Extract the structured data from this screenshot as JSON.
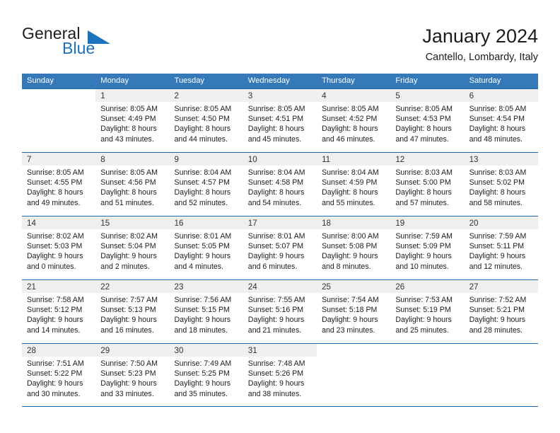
{
  "brand": {
    "name_part1": "General",
    "name_part2": "Blue",
    "flag_icon": "blue-triangle-flag-icon",
    "accent_color": "#1b72bd"
  },
  "header": {
    "title": "January 2024",
    "subtitle": "Cantello, Lombardy, Italy"
  },
  "colors": {
    "header_row_bg": "#3579b8",
    "row_divider": "#1b6bb0",
    "daynum_band_bg": "#efefef",
    "text": "#1c1c1c"
  },
  "calendar": {
    "weekday_headers": [
      "Sunday",
      "Monday",
      "Tuesday",
      "Wednesday",
      "Thursday",
      "Friday",
      "Saturday"
    ],
    "weeks": [
      [
        {
          "day": "",
          "lines": []
        },
        {
          "day": "1",
          "lines": [
            "Sunrise: 8:05 AM",
            "Sunset: 4:49 PM",
            "Daylight: 8 hours",
            "and 43 minutes."
          ]
        },
        {
          "day": "2",
          "lines": [
            "Sunrise: 8:05 AM",
            "Sunset: 4:50 PM",
            "Daylight: 8 hours",
            "and 44 minutes."
          ]
        },
        {
          "day": "3",
          "lines": [
            "Sunrise: 8:05 AM",
            "Sunset: 4:51 PM",
            "Daylight: 8 hours",
            "and 45 minutes."
          ]
        },
        {
          "day": "4",
          "lines": [
            "Sunrise: 8:05 AM",
            "Sunset: 4:52 PM",
            "Daylight: 8 hours",
            "and 46 minutes."
          ]
        },
        {
          "day": "5",
          "lines": [
            "Sunrise: 8:05 AM",
            "Sunset: 4:53 PM",
            "Daylight: 8 hours",
            "and 47 minutes."
          ]
        },
        {
          "day": "6",
          "lines": [
            "Sunrise: 8:05 AM",
            "Sunset: 4:54 PM",
            "Daylight: 8 hours",
            "and 48 minutes."
          ]
        }
      ],
      [
        {
          "day": "7",
          "lines": [
            "Sunrise: 8:05 AM",
            "Sunset: 4:55 PM",
            "Daylight: 8 hours",
            "and 49 minutes."
          ]
        },
        {
          "day": "8",
          "lines": [
            "Sunrise: 8:05 AM",
            "Sunset: 4:56 PM",
            "Daylight: 8 hours",
            "and 51 minutes."
          ]
        },
        {
          "day": "9",
          "lines": [
            "Sunrise: 8:04 AM",
            "Sunset: 4:57 PM",
            "Daylight: 8 hours",
            "and 52 minutes."
          ]
        },
        {
          "day": "10",
          "lines": [
            "Sunrise: 8:04 AM",
            "Sunset: 4:58 PM",
            "Daylight: 8 hours",
            "and 54 minutes."
          ]
        },
        {
          "day": "11",
          "lines": [
            "Sunrise: 8:04 AM",
            "Sunset: 4:59 PM",
            "Daylight: 8 hours",
            "and 55 minutes."
          ]
        },
        {
          "day": "12",
          "lines": [
            "Sunrise: 8:03 AM",
            "Sunset: 5:00 PM",
            "Daylight: 8 hours",
            "and 57 minutes."
          ]
        },
        {
          "day": "13",
          "lines": [
            "Sunrise: 8:03 AM",
            "Sunset: 5:02 PM",
            "Daylight: 8 hours",
            "and 58 minutes."
          ]
        }
      ],
      [
        {
          "day": "14",
          "lines": [
            "Sunrise: 8:02 AM",
            "Sunset: 5:03 PM",
            "Daylight: 9 hours",
            "and 0 minutes."
          ]
        },
        {
          "day": "15",
          "lines": [
            "Sunrise: 8:02 AM",
            "Sunset: 5:04 PM",
            "Daylight: 9 hours",
            "and 2 minutes."
          ]
        },
        {
          "day": "16",
          "lines": [
            "Sunrise: 8:01 AM",
            "Sunset: 5:05 PM",
            "Daylight: 9 hours",
            "and 4 minutes."
          ]
        },
        {
          "day": "17",
          "lines": [
            "Sunrise: 8:01 AM",
            "Sunset: 5:07 PM",
            "Daylight: 9 hours",
            "and 6 minutes."
          ]
        },
        {
          "day": "18",
          "lines": [
            "Sunrise: 8:00 AM",
            "Sunset: 5:08 PM",
            "Daylight: 9 hours",
            "and 8 minutes."
          ]
        },
        {
          "day": "19",
          "lines": [
            "Sunrise: 7:59 AM",
            "Sunset: 5:09 PM",
            "Daylight: 9 hours",
            "and 10 minutes."
          ]
        },
        {
          "day": "20",
          "lines": [
            "Sunrise: 7:59 AM",
            "Sunset: 5:11 PM",
            "Daylight: 9 hours",
            "and 12 minutes."
          ]
        }
      ],
      [
        {
          "day": "21",
          "lines": [
            "Sunrise: 7:58 AM",
            "Sunset: 5:12 PM",
            "Daylight: 9 hours",
            "and 14 minutes."
          ]
        },
        {
          "day": "22",
          "lines": [
            "Sunrise: 7:57 AM",
            "Sunset: 5:13 PM",
            "Daylight: 9 hours",
            "and 16 minutes."
          ]
        },
        {
          "day": "23",
          "lines": [
            "Sunrise: 7:56 AM",
            "Sunset: 5:15 PM",
            "Daylight: 9 hours",
            "and 18 minutes."
          ]
        },
        {
          "day": "24",
          "lines": [
            "Sunrise: 7:55 AM",
            "Sunset: 5:16 PM",
            "Daylight: 9 hours",
            "and 21 minutes."
          ]
        },
        {
          "day": "25",
          "lines": [
            "Sunrise: 7:54 AM",
            "Sunset: 5:18 PM",
            "Daylight: 9 hours",
            "and 23 minutes."
          ]
        },
        {
          "day": "26",
          "lines": [
            "Sunrise: 7:53 AM",
            "Sunset: 5:19 PM",
            "Daylight: 9 hours",
            "and 25 minutes."
          ]
        },
        {
          "day": "27",
          "lines": [
            "Sunrise: 7:52 AM",
            "Sunset: 5:21 PM",
            "Daylight: 9 hours",
            "and 28 minutes."
          ]
        }
      ],
      [
        {
          "day": "28",
          "lines": [
            "Sunrise: 7:51 AM",
            "Sunset: 5:22 PM",
            "Daylight: 9 hours",
            "and 30 minutes."
          ]
        },
        {
          "day": "29",
          "lines": [
            "Sunrise: 7:50 AM",
            "Sunset: 5:23 PM",
            "Daylight: 9 hours",
            "and 33 minutes."
          ]
        },
        {
          "day": "30",
          "lines": [
            "Sunrise: 7:49 AM",
            "Sunset: 5:25 PM",
            "Daylight: 9 hours",
            "and 35 minutes."
          ]
        },
        {
          "day": "31",
          "lines": [
            "Sunrise: 7:48 AM",
            "Sunset: 5:26 PM",
            "Daylight: 9 hours",
            "and 38 minutes."
          ]
        },
        {
          "day": "",
          "lines": []
        },
        {
          "day": "",
          "lines": []
        },
        {
          "day": "",
          "lines": []
        }
      ]
    ]
  }
}
